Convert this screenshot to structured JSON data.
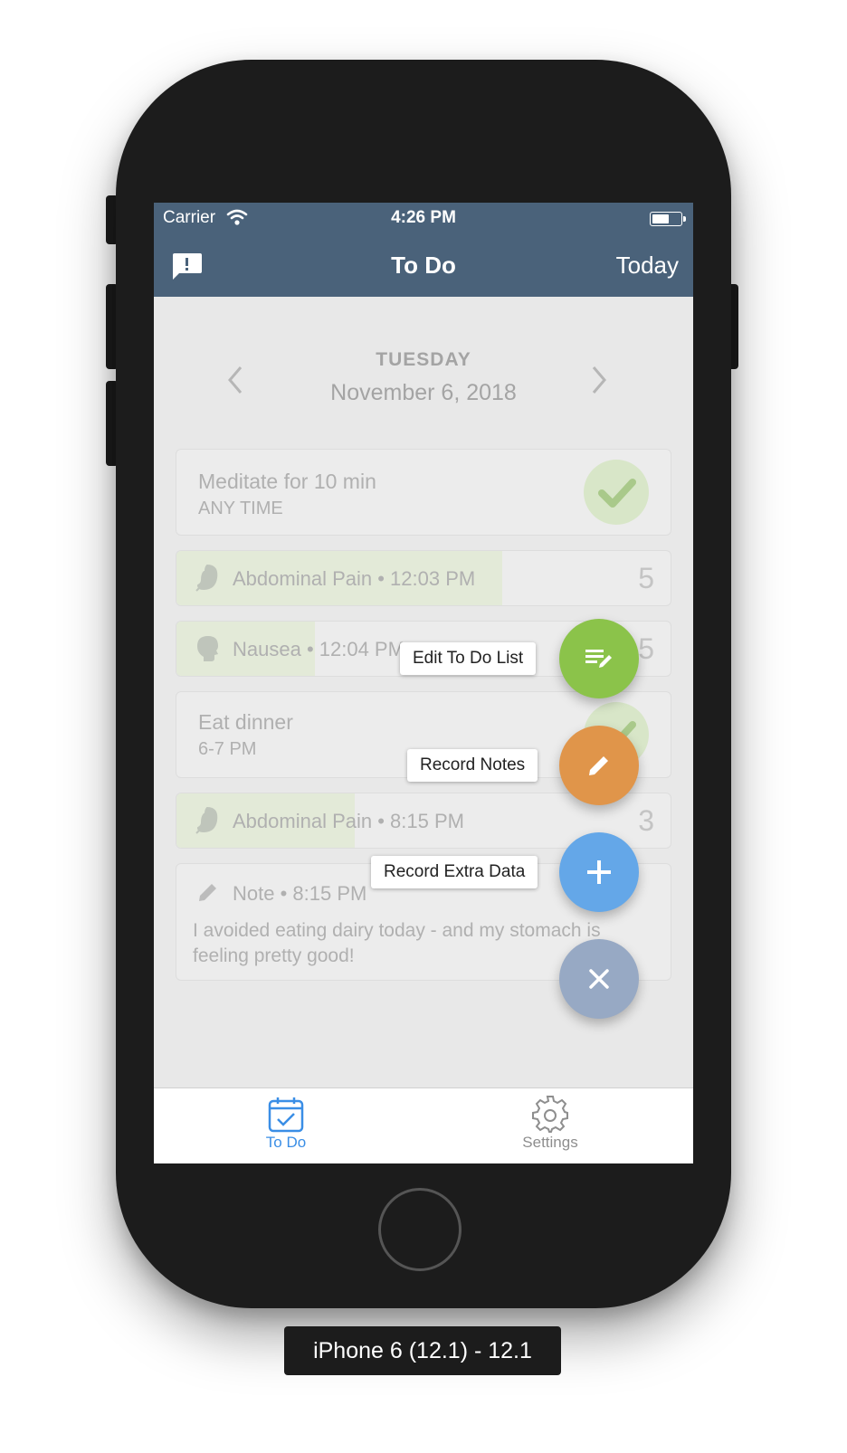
{
  "status_bar": {
    "carrier": "Carrier",
    "time": "4:26 PM"
  },
  "nav": {
    "title": "To Do",
    "right_button": "Today"
  },
  "date": {
    "day": "TUESDAY",
    "full": "November 6, 2018"
  },
  "cards": {
    "meditate": {
      "title": "Meditate for 10 min",
      "subtitle": "ANY TIME"
    },
    "abdominal1": {
      "label": "Abdominal Pain • 12:03 PM",
      "value": "5",
      "level": 0.66
    },
    "nausea": {
      "label": "Nausea • 12:04 PM",
      "value": "5",
      "level": 0.28
    },
    "dinner": {
      "title": "Eat dinner",
      "subtitle": "6-7 PM"
    },
    "abdominal2": {
      "label": "Abdominal Pain • 8:15 PM",
      "value": "3",
      "level": 0.36
    },
    "note": {
      "label": "Note • 8:15 PM",
      "text": "I avoided eating dairy today - and my stomach is feeling pretty good!"
    }
  },
  "fab_menu": {
    "edit_label": "Edit To Do List",
    "notes_label": "Record Notes",
    "extra_label": "Record Extra Data"
  },
  "tabs": {
    "todo": "To Do",
    "settings": "Settings"
  },
  "device_label": "iPhone 6 (12.1) - 12.1",
  "colors": {
    "nav_bg": "#4a627a",
    "fab_green": "#8bc34a",
    "fab_orange": "#e0954a",
    "fab_blue": "#64a7e8",
    "fab_close": "#97a9c4",
    "tab_active": "#3a8ee6",
    "tab_inactive": "#8e8e8e"
  }
}
